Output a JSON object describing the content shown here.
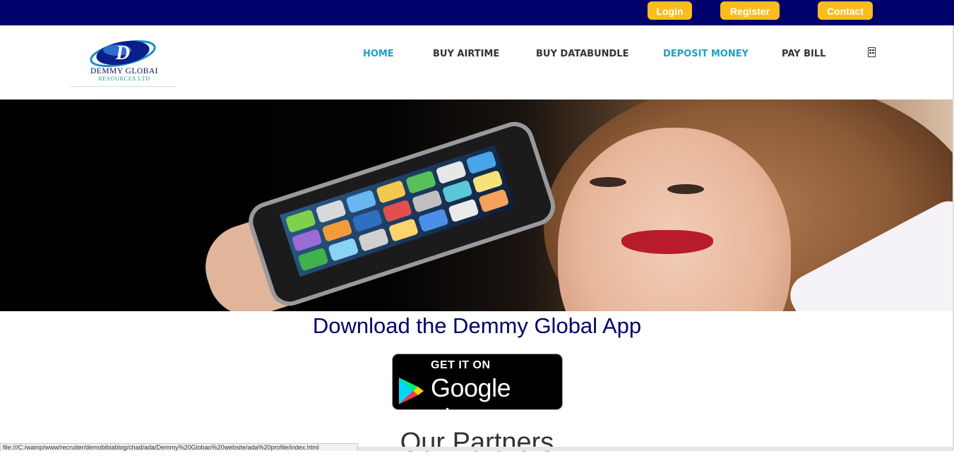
{
  "topbar": {
    "login_label": "Login",
    "register_label": "Register",
    "contact_label": "Contact"
  },
  "logo": {
    "letter": "D",
    "name": "DEMMY GLOBAI",
    "subtitle": "RESOURCES LTD"
  },
  "nav": {
    "items": [
      {
        "label": "HOME",
        "active": true
      },
      {
        "label": "BUY AIRTIME",
        "active": false
      },
      {
        "label": "BUY DATABUNDLE",
        "active": false
      },
      {
        "label": "DEPOSIT MONEY",
        "active": true
      },
      {
        "label": "PAY BILL",
        "active": false
      }
    ],
    "extra_icon": "menu-toggle-icon"
  },
  "main": {
    "download_heading": "Download the Demmy Global App",
    "play_badge": {
      "top_line": "GET IT ON",
      "main_line": "Google play"
    },
    "partners_heading": "Our Partners"
  },
  "status_bar": {
    "url": "file:///C:/wamp/www/recruiter/demobibiablog/chad/ada/Demmy%20Globao%20website/ada%20profile/index.html"
  },
  "colors": {
    "topbar_bg": "#01016b",
    "button_bg": "#fbbd1c",
    "nav_active": "#1da1c9",
    "nav_text": "#333333",
    "heading": "#01016b"
  }
}
